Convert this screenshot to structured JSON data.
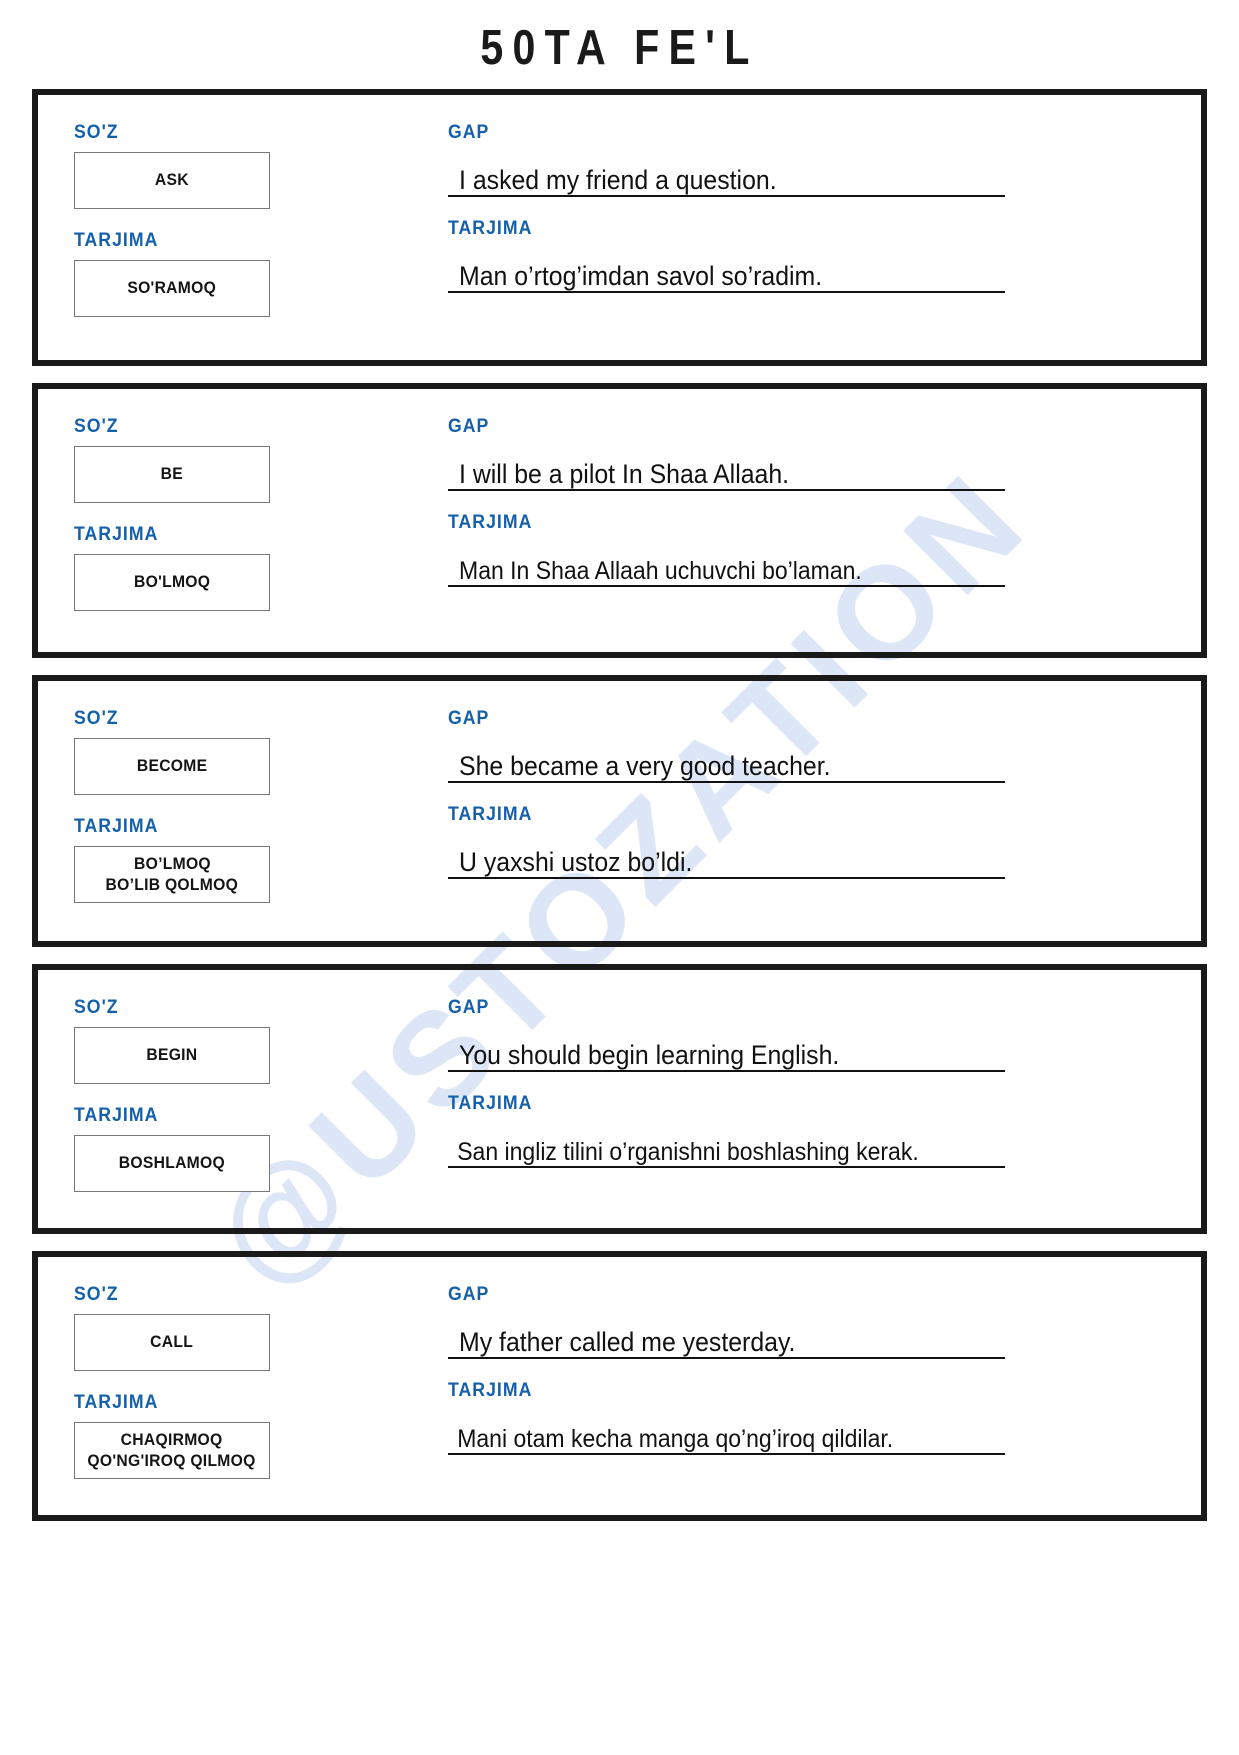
{
  "document": {
    "title": "50TA FE'L",
    "watermark": "@USTOZATION",
    "labels": {
      "word": "SO'Z",
      "translation": "TARJIMA",
      "sentence": "GAP"
    },
    "accent_color": "#1560ab",
    "border_color": "#1a1a1a"
  },
  "cards": [
    {
      "word": "ASK",
      "word_translation": "SO'RAMOQ",
      "word_translation_line2": "",
      "sentence": "I asked my friend a question.",
      "sentence_translation": "Man o’rtog’imdan savol so’radim."
    },
    {
      "word": "BE",
      "word_translation": "BO'LMOQ",
      "word_translation_line2": "",
      "sentence": "I will be a pilot In Shaa Allaah.",
      "sentence_translation": "Man In Shaa Allaah uchuvchi bo’laman."
    },
    {
      "word": "BECOME",
      "word_translation": "BO’LMOQ",
      "word_translation_line2": "BO’LIB QOLMOQ",
      "sentence": "She became a very good teacher.",
      "sentence_translation": "U yaxshi ustoz bo’ldi."
    },
    {
      "word": "BEGIN",
      "word_translation": "BOSHLAMOQ",
      "word_translation_line2": "",
      "sentence": "You should begin learning English.",
      "sentence_translation": "San ingliz tilini o’rganishni boshlashing kerak."
    },
    {
      "word": "CALL",
      "word_translation": "CHAQIRMOQ",
      "word_translation_line2": "QO'NG'IROQ QILMOQ",
      "sentence": "My father called me yesterday.",
      "sentence_translation": "Mani otam kecha manga qo’ng’iroq qildilar."
    }
  ]
}
